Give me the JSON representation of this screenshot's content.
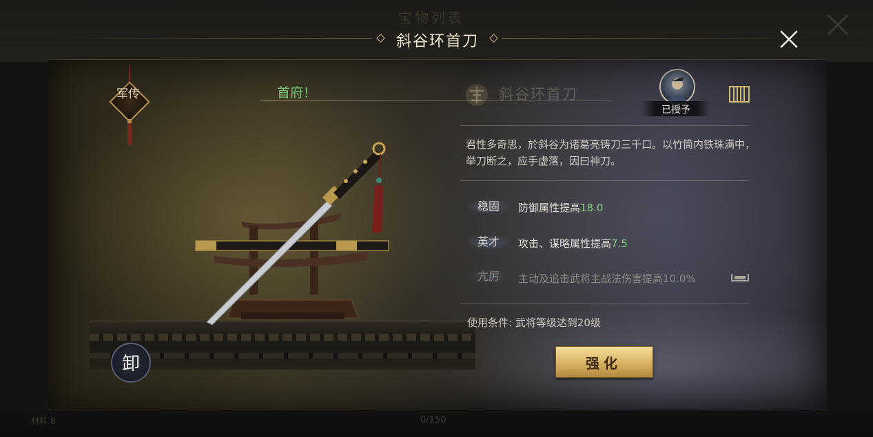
{
  "background": {
    "ghost_title": "宝物列表",
    "ghost_bottom_left": "材料 8",
    "ghost_bottom_counter": "0/150"
  },
  "header": {
    "title": "斜谷环首刀",
    "close_icon": "close-icon"
  },
  "badge": {
    "text": "军传"
  },
  "unequip": {
    "label": "卸"
  },
  "item": {
    "owner_text": "首府！",
    "watermark_name": "斜谷环首刀",
    "granted_label": "已授予",
    "description": "君性多奇思，於斜谷为诸葛亮铸刀三千口。以竹筒内铁珠满中，举刀断之，应手虚落，因曰神刀。"
  },
  "attributes": [
    {
      "tag": "稳固",
      "text": "防御属性提高",
      "value": "18.0",
      "active": true
    },
    {
      "tag": "英才",
      "text": "攻击、谋略属性提高",
      "value": "7.5",
      "active": true
    },
    {
      "tag": "亢厉",
      "text": "主动及追击武将主战法伤害提高10.0%",
      "value": "",
      "active": false
    }
  ],
  "requirement": "使用条件: 武将等级达到20级",
  "actions": {
    "enhance_label": "强化"
  },
  "colors": {
    "accent_gold": "#d9b364",
    "value_green": "#86d27f",
    "owner_green": "#7fd07a"
  }
}
